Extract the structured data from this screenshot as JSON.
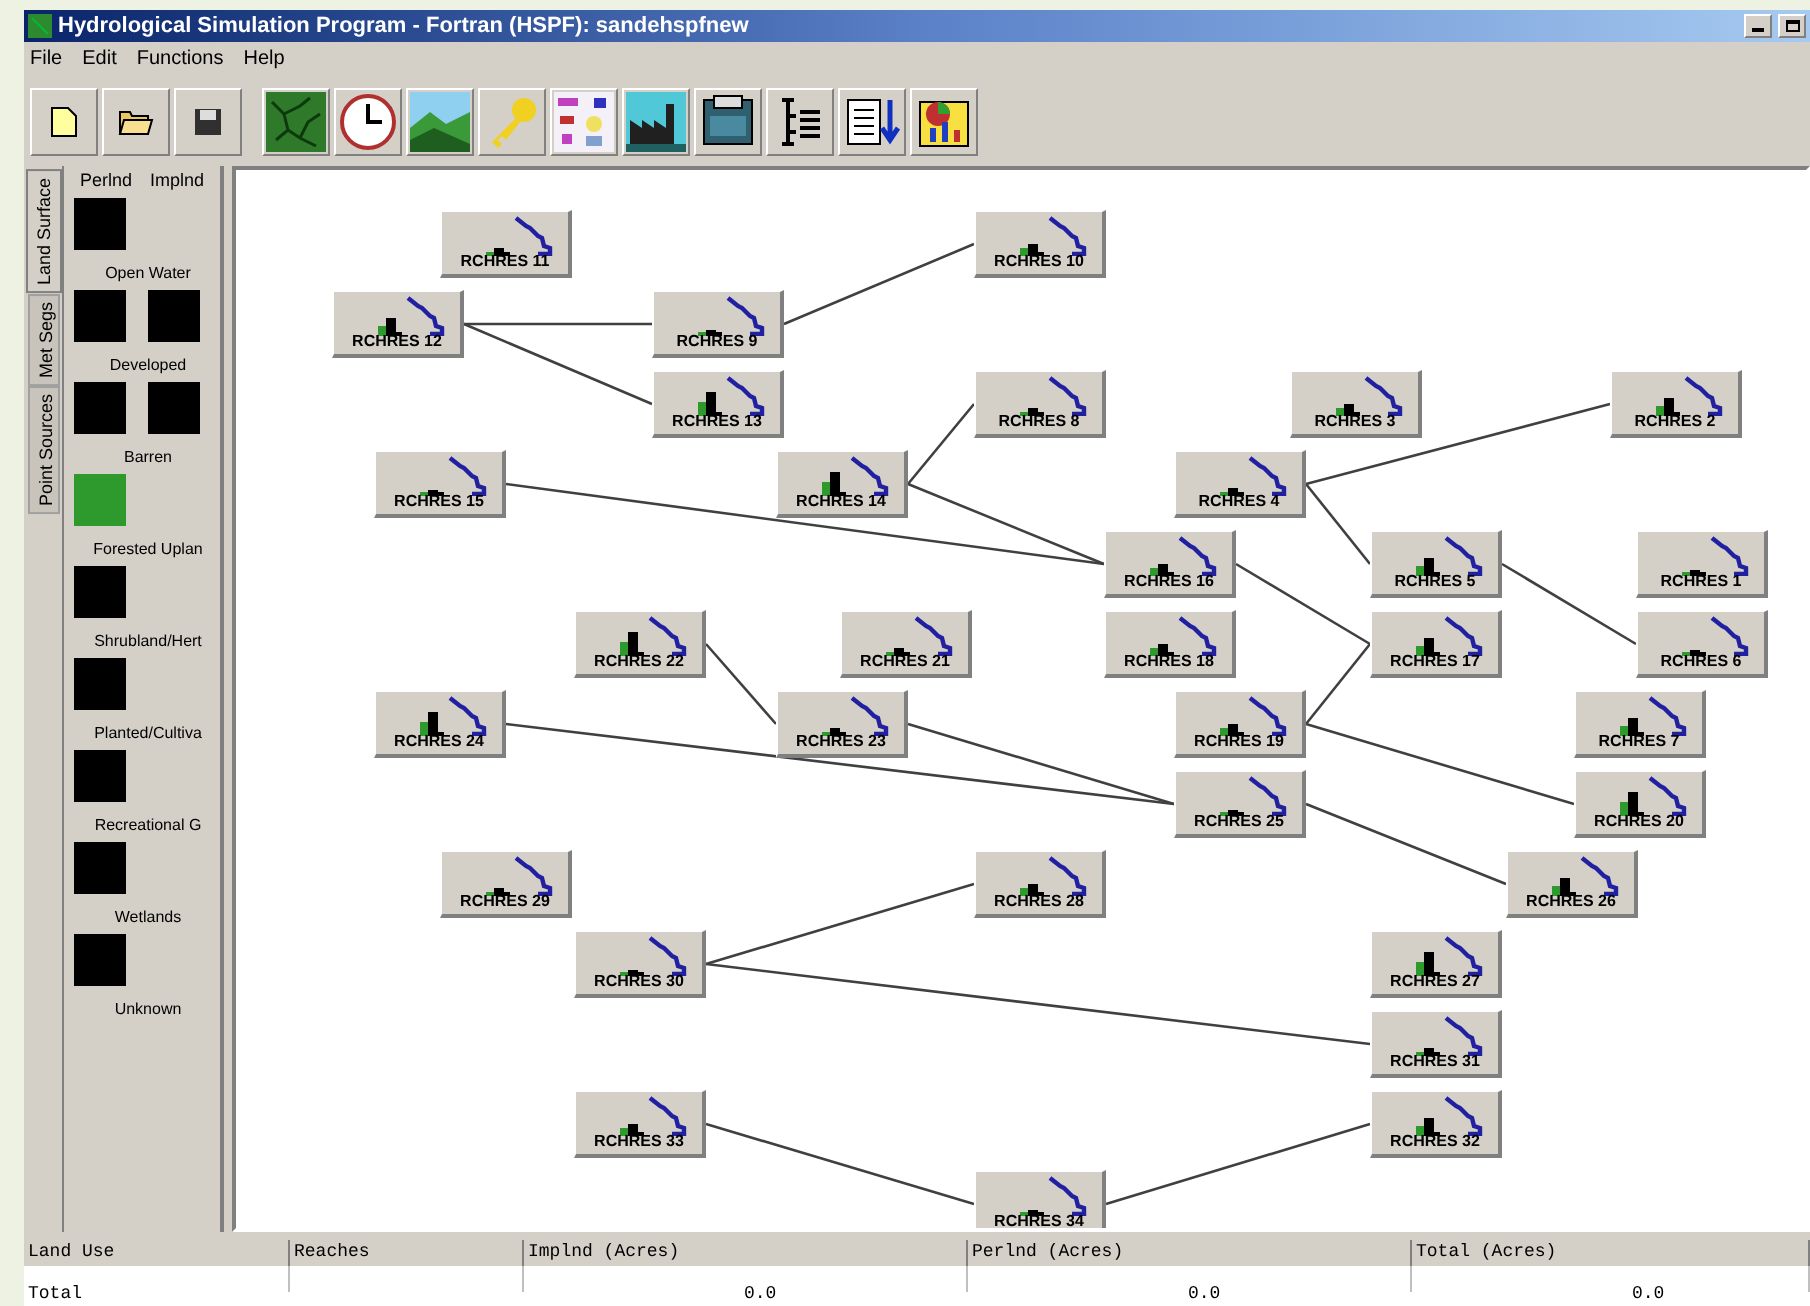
{
  "window": {
    "title": "Hydrological Simulation Program - Fortran (HSPF): sandehspfnew"
  },
  "menu": [
    "File",
    "Edit",
    "Functions",
    "Help"
  ],
  "side_tabs": [
    {
      "label": "Land Surface",
      "selected": true
    },
    {
      "label": "Met Segs",
      "selected": false
    },
    {
      "label": "Point Sources",
      "selected": false
    }
  ],
  "land_use": {
    "headers": [
      "Perlnd",
      "Implnd"
    ],
    "items": [
      {
        "label": "Open Water",
        "segments": [
          {
            "color": "#000000"
          }
        ]
      },
      {
        "label": "Developed",
        "segments": [
          {
            "color": "#000000"
          },
          {
            "color": "#000000"
          }
        ]
      },
      {
        "label": "Barren",
        "segments": [
          {
            "color": "#000000"
          },
          {
            "color": "#000000"
          }
        ]
      },
      {
        "label": "Forested Uplan",
        "segments": [
          {
            "color": "#2e9a2e"
          }
        ]
      },
      {
        "label": "Shrubland/Hert",
        "segments": [
          {
            "color": "#000000"
          }
        ]
      },
      {
        "label": "Planted/Cultiva",
        "segments": [
          {
            "color": "#000000"
          }
        ]
      },
      {
        "label": "Recreational G",
        "segments": [
          {
            "color": "#000000"
          }
        ]
      },
      {
        "label": "Wetlands",
        "segments": [
          {
            "color": "#000000"
          }
        ]
      },
      {
        "label": "Unknown",
        "segments": [
          {
            "color": "#000000"
          }
        ]
      }
    ]
  },
  "reaches": [
    {
      "label": "RCHRES 11"
    },
    {
      "label": "RCHRES 10"
    },
    {
      "label": "RCHRES 12"
    },
    {
      "label": "RCHRES 9"
    },
    {
      "label": "RCHRES 13"
    },
    {
      "label": "RCHRES 8"
    },
    {
      "label": "RCHRES 3"
    },
    {
      "label": "RCHRES 2"
    },
    {
      "label": "RCHRES 15"
    },
    {
      "label": "RCHRES 14"
    },
    {
      "label": "RCHRES 4"
    },
    {
      "label": "RCHRES 16"
    },
    {
      "label": "RCHRES 5"
    },
    {
      "label": "RCHRES 1"
    },
    {
      "label": "RCHRES 22"
    },
    {
      "label": "RCHRES 21"
    },
    {
      "label": "RCHRES 18"
    },
    {
      "label": "RCHRES 17"
    },
    {
      "label": "RCHRES 6"
    },
    {
      "label": "RCHRES 24"
    },
    {
      "label": "RCHRES 23"
    },
    {
      "label": "RCHRES 19"
    },
    {
      "label": "RCHRES 7"
    },
    {
      "label": "RCHRES 25"
    },
    {
      "label": "RCHRES 20"
    },
    {
      "label": "RCHRES 29"
    },
    {
      "label": "RCHRES 28"
    },
    {
      "label": "RCHRES 26"
    },
    {
      "label": "RCHRES 30"
    },
    {
      "label": "RCHRES 27"
    },
    {
      "label": "RCHRES 31"
    },
    {
      "label": "RCHRES 33"
    },
    {
      "label": "RCHRES 32"
    },
    {
      "label": "RCHRES 34"
    }
  ],
  "table": {
    "columns": [
      "Land Use",
      "Reaches",
      "Implnd (Acres)",
      "Perlnd (Acres)",
      "Total (Acres)"
    ],
    "rows": [
      [
        "Total",
        "",
        "0.0",
        "0.0",
        "0.0"
      ]
    ]
  }
}
